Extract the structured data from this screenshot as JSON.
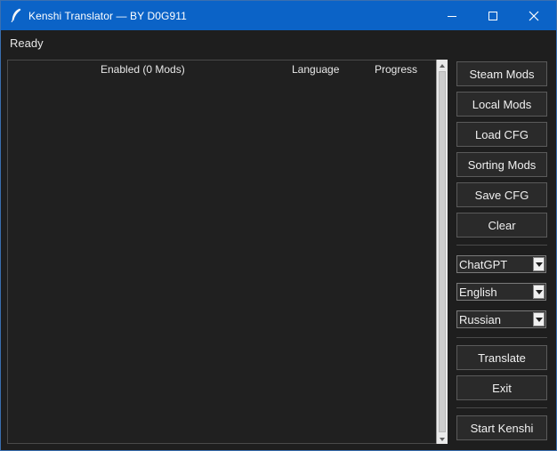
{
  "window": {
    "title": "Kenshi Translator — BY D0G911",
    "icon": "feather-icon",
    "controls": [
      "minimize-icon",
      "maximize-icon",
      "close-icon"
    ],
    "titlebar_color": "#0b63c7"
  },
  "status": "Ready",
  "mod_list": {
    "columns": [
      "Enabled (0 Mods)",
      "Language",
      "Progress"
    ],
    "rows": []
  },
  "buttons": {
    "steam_mods": "Steam Mods",
    "local_mods": "Local Mods",
    "load_cfg": "Load CFG",
    "sorting_mods": "Sorting Mods",
    "save_cfg": "Save CFG",
    "clear": "Clear",
    "translate": "Translate",
    "exit": "Exit",
    "start_kenshi": "Start Kenshi"
  },
  "selectors": {
    "engine": "ChatGPT",
    "source_language": "English",
    "target_language": "Russian"
  }
}
